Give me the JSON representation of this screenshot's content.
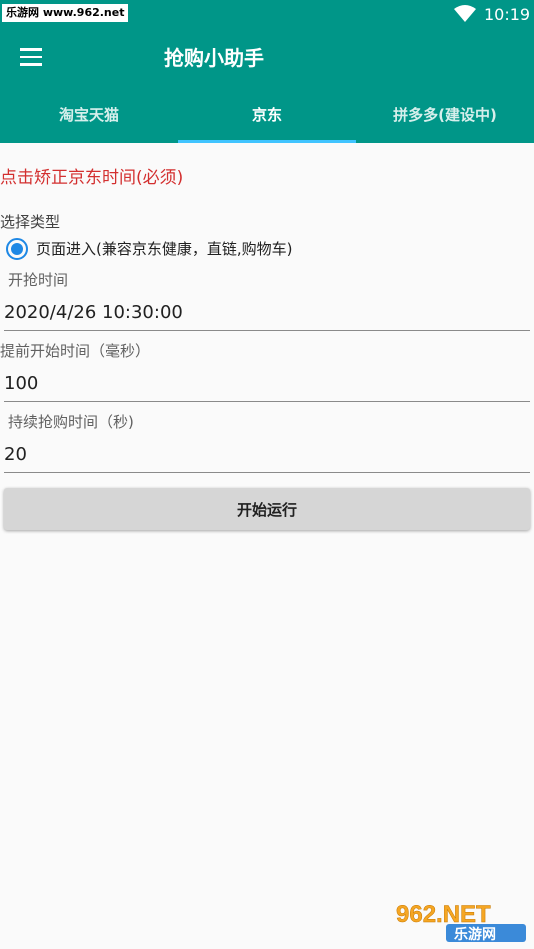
{
  "status_bar": {
    "watermark": "乐游网 www.962.net",
    "time": "10:19"
  },
  "toolbar": {
    "title": "抢购小助手"
  },
  "tabs": [
    {
      "label": "淘宝天猫",
      "active": false
    },
    {
      "label": "京东",
      "active": true
    },
    {
      "label": "拼多多(建设中)",
      "active": false
    }
  ],
  "main": {
    "calibrate_link": "点击矫正京东时间(必须)",
    "type_label": "选择类型",
    "type_option": "页面进入(兼容京东健康，直链,购物车)",
    "start_time_label": "开抢时间",
    "start_time_value": "2020/4/26 10:30:00",
    "advance_label": "提前开始时间（毫秒）",
    "advance_value": "100",
    "duration_label": "持续抢购时间（秒)",
    "duration_value": "20",
    "run_button": "开始运行"
  },
  "watermark_logo": {
    "text_top": "962.NET",
    "text_bottom": "乐游网"
  },
  "colors": {
    "primary": "#009688",
    "accent": "#40c4ff",
    "link_red": "#d32f2f",
    "radio_blue": "#1e88e5"
  }
}
